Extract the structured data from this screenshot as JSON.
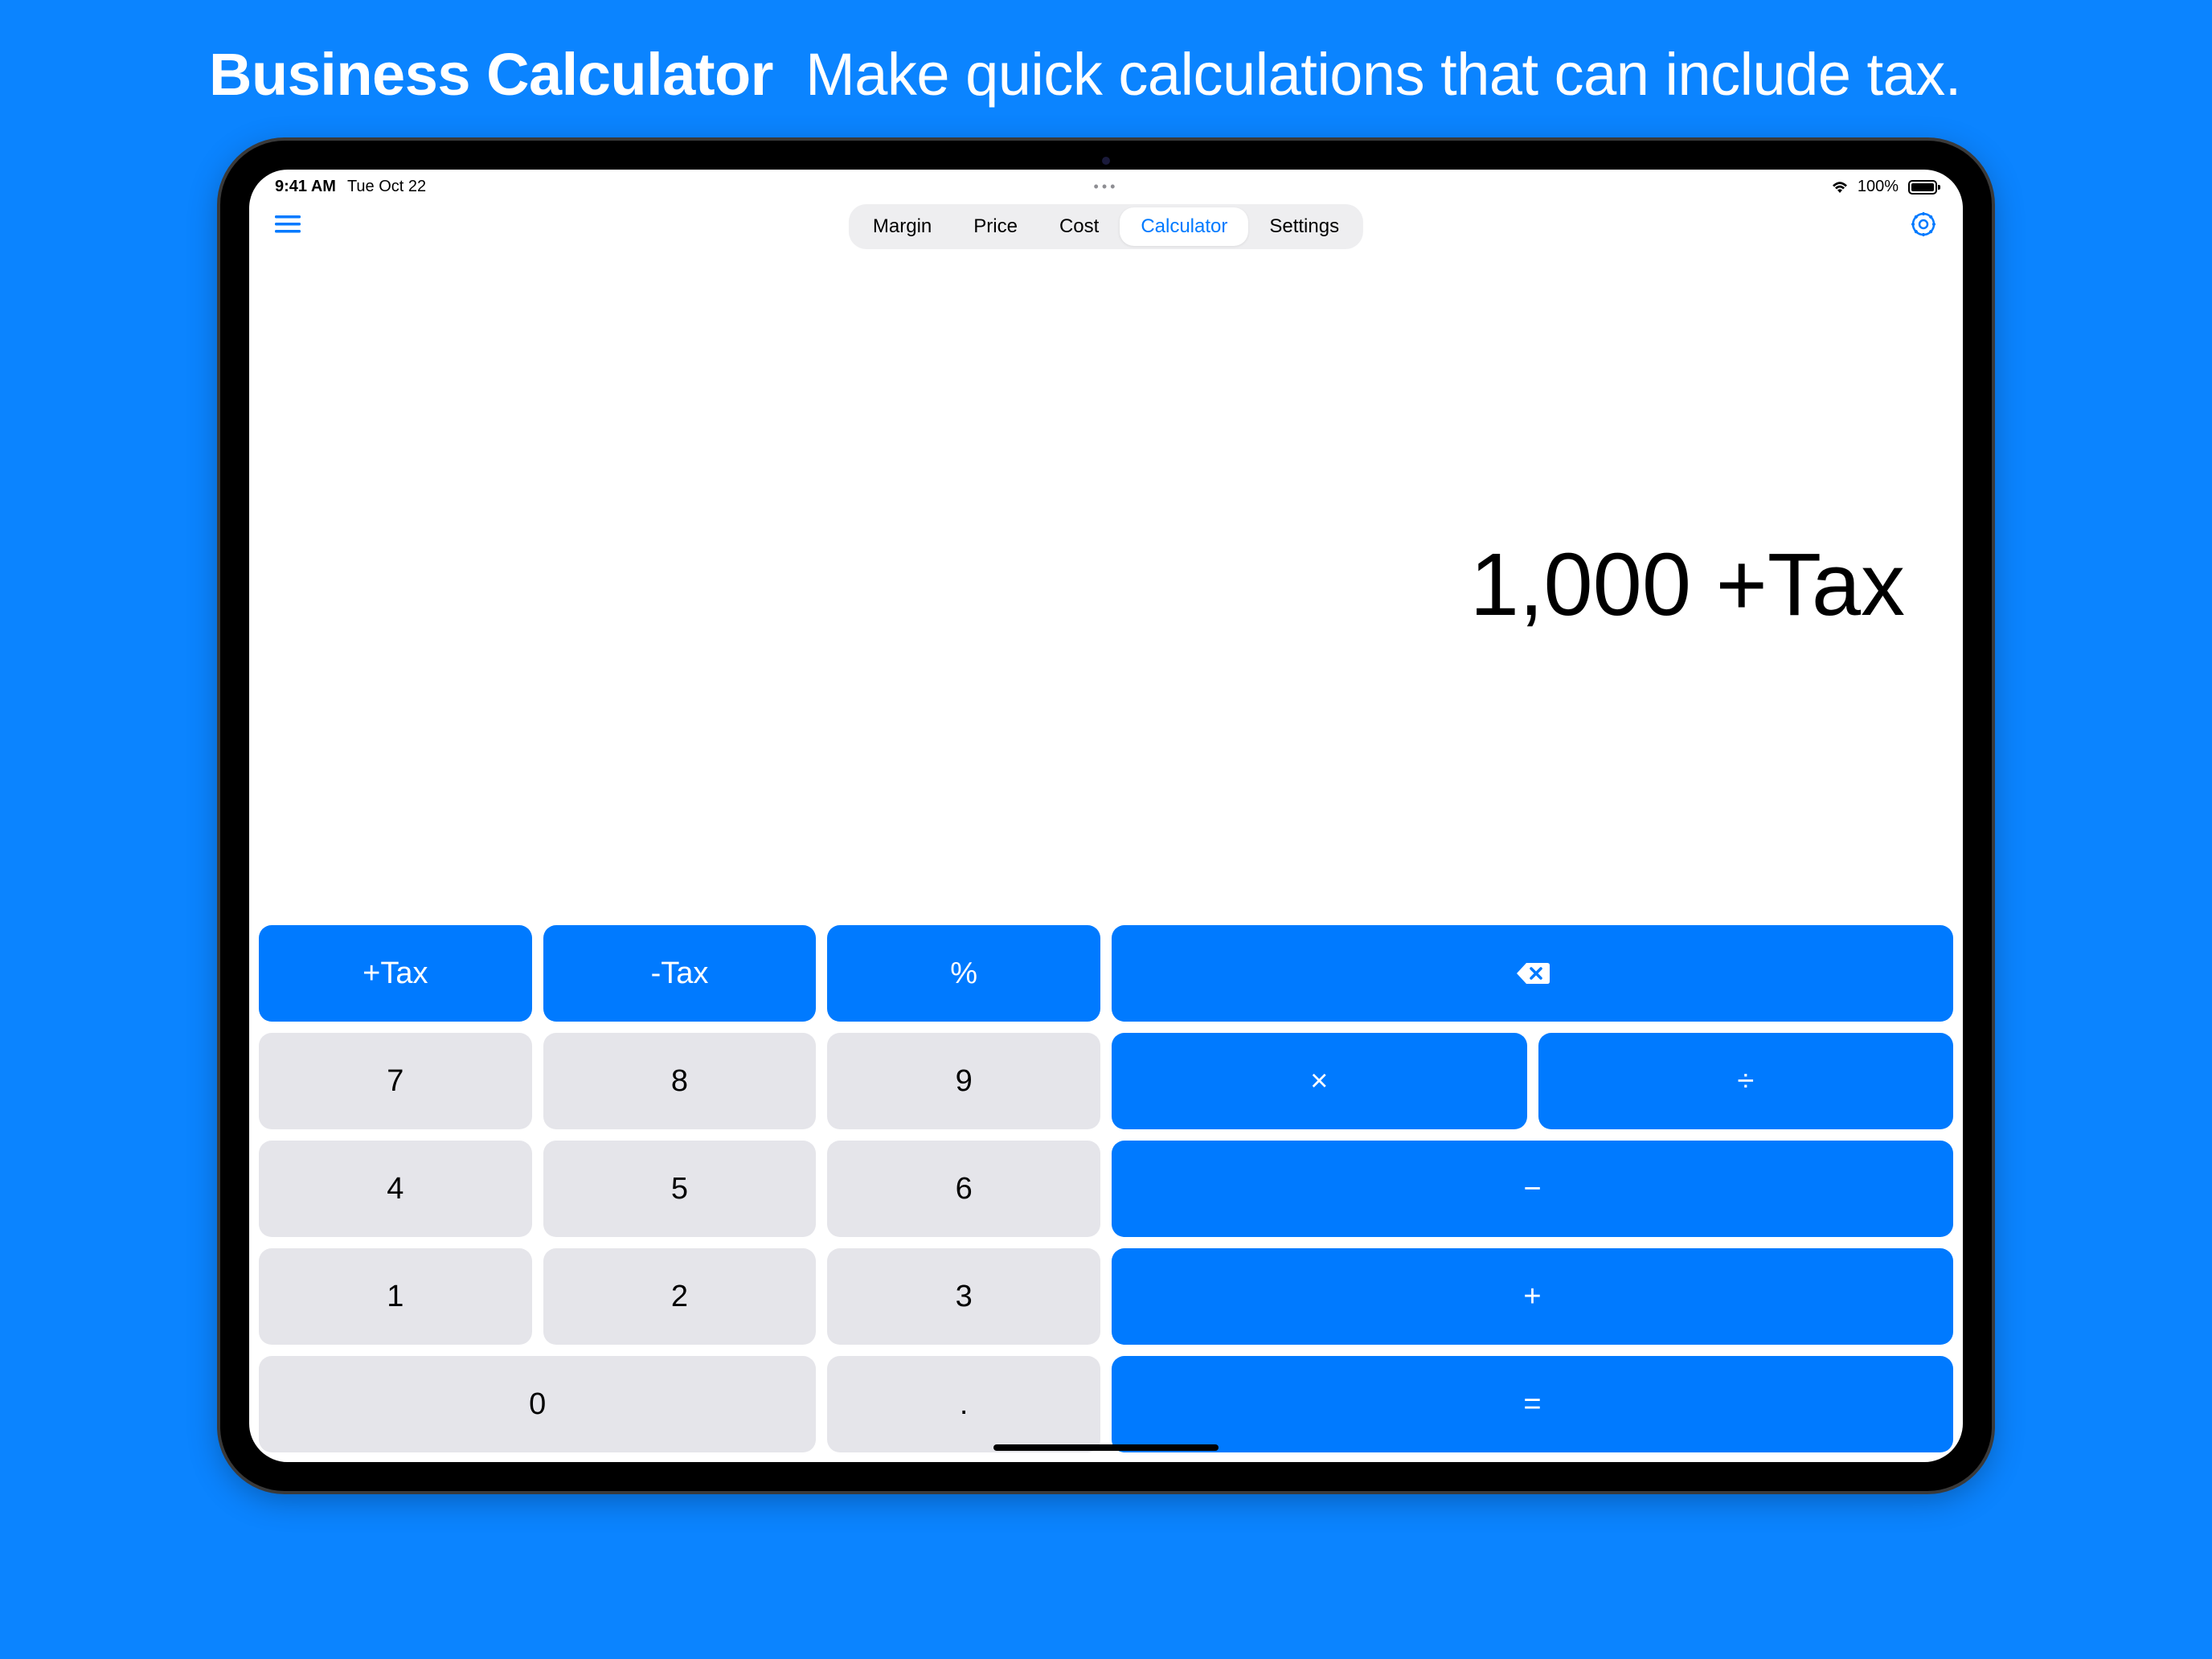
{
  "promo": {
    "title": "Business Calculator",
    "subtitle": "Make quick calculations that can include tax."
  },
  "statusBar": {
    "time": "9:41 AM",
    "date": "Tue Oct 22",
    "dots": "•••",
    "battery": "100%"
  },
  "tabs": [
    {
      "label": "Margin",
      "active": false
    },
    {
      "label": "Price",
      "active": false
    },
    {
      "label": "Cost",
      "active": false
    },
    {
      "label": "Calculator",
      "active": true
    },
    {
      "label": "Settings",
      "active": false
    }
  ],
  "display": "1,000 +Tax",
  "keys": {
    "addTax": "+Tax",
    "subTax": "-Tax",
    "percent": "%",
    "seven": "7",
    "eight": "8",
    "nine": "9",
    "four": "4",
    "five": "5",
    "six": "6",
    "one": "1",
    "two": "2",
    "three": "3",
    "zero": "0",
    "decimal": ".",
    "multiply": "×",
    "divide": "÷",
    "minus": "−",
    "plus": "+",
    "equals": "="
  }
}
